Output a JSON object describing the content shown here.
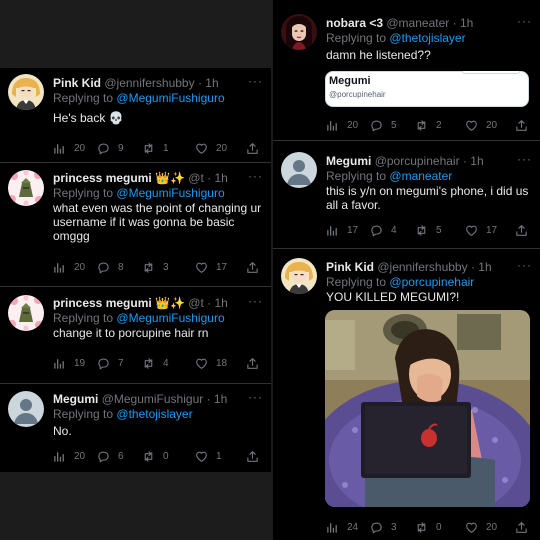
{
  "left_tweets": [
    {
      "name": "Pink Kid",
      "handle": "@jennifershubby",
      "time": "· 1h",
      "more": "···",
      "reply_prefix": "Replying to",
      "reply_to": "@MegumiFushiguro",
      "text": "He's back 💀",
      "stats": {
        "views": "20",
        "replies": "9",
        "retweets": "1",
        "likes": "20"
      }
    },
    {
      "name": "princess megumi 👑✨",
      "handle": "@t",
      "time": "· 1h",
      "more": "···",
      "reply_prefix": "Replying to",
      "reply_to": "@MegumiFushiguro",
      "text": "what even was the point of changing ur username if it was gonna be basic omggg",
      "stats": {
        "views": "20",
        "replies": "8",
        "retweets": "3",
        "likes": "17"
      }
    },
    {
      "name": "princess megumi 👑✨",
      "handle": "@t",
      "time": "· 1h",
      "more": "···",
      "reply_prefix": "Replying to",
      "reply_to": "@MegumiFushiguro",
      "text": "change it to porcupine hair rn",
      "stats": {
        "views": "19",
        "replies": "7",
        "retweets": "4",
        "likes": "18"
      }
    },
    {
      "name": "Megumi",
      "handle": "@MegumiFushigur",
      "time": "· 1h",
      "more": "···",
      "reply_prefix": "Replying to",
      "reply_to": "@thetojislayer",
      "text": "No.",
      "stats": {
        "views": "20",
        "replies": "6",
        "retweets": "0",
        "likes": "1"
      }
    }
  ],
  "right_tweets": [
    {
      "name": "nobara <3",
      "handle": "@maneater",
      "time": "· 1h",
      "more": "···",
      "reply_prefix": "Replying to",
      "reply_to": "@thetojislayer",
      "text": "damn he listened??",
      "quote": {
        "name": "Megumi",
        "handle": "@porcupinehair"
      },
      "stats": {
        "views": "20",
        "replies": "5",
        "retweets": "2",
        "likes": "20"
      }
    },
    {
      "name": "Megumi",
      "handle": "@porcupinehair",
      "time": "· 1h",
      "more": "···",
      "reply_prefix": "Replying to",
      "reply_to": "@maneater",
      "text": "this is y/n on megumi's phone, i did us all a favor.",
      "stats": {
        "views": "17",
        "replies": "4",
        "retweets": "5",
        "likes": "17"
      }
    },
    {
      "name": "Pink Kid",
      "handle": "@jennifershubby",
      "time": "· 1h",
      "more": "···",
      "reply_prefix": "Replying to",
      "reply_to": "@porcupinehair",
      "text": "YOU KILLED MEGUMI?!",
      "stats": {
        "views": "24",
        "replies": "3",
        "retweets": "0",
        "likes": "20"
      }
    }
  ],
  "colors": {
    "background": "#000000",
    "text": "#e7e9ea",
    "muted": "#71767b",
    "link": "#1d9bf0"
  }
}
